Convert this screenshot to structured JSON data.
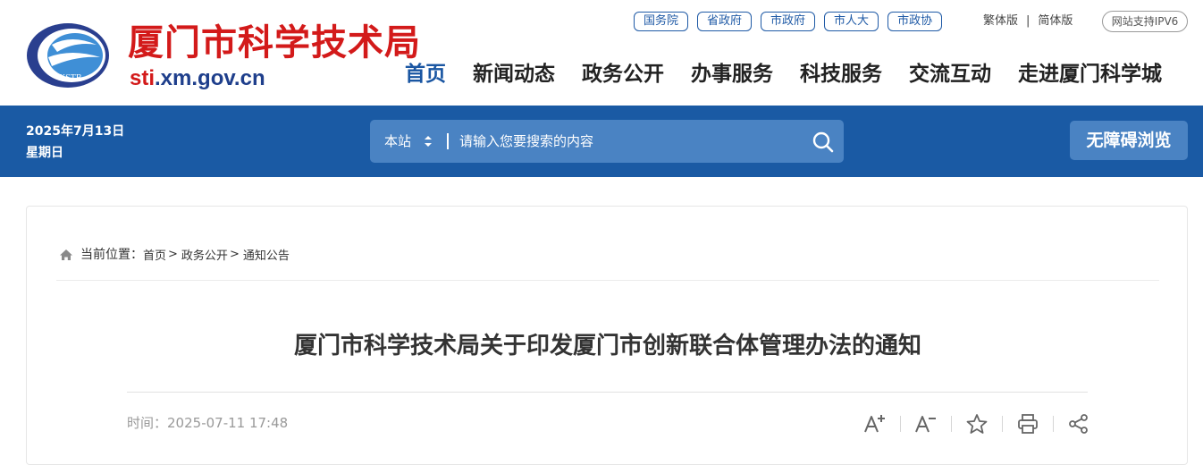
{
  "site": {
    "title": "厦门市科学技术局",
    "domain_prefix": "sti",
    "domain_suffix": ".xm.gov.cn",
    "emblem_text": "XSTB"
  },
  "top_links": [
    "国务院",
    "省政府",
    "市政府",
    "市人大",
    "市政协"
  ],
  "lang": {
    "traditional": "繁体版",
    "separator": "|",
    "simplified": "简体版"
  },
  "ipv6_badge": "网站支持IPV6",
  "nav": [
    {
      "label": "首页",
      "active": true
    },
    {
      "label": "新闻动态",
      "active": false
    },
    {
      "label": "政务公开",
      "active": false
    },
    {
      "label": "办事服务",
      "active": false
    },
    {
      "label": "科技服务",
      "active": false
    },
    {
      "label": "交流互动",
      "active": false
    },
    {
      "label": "走进厦门科学城",
      "active": false
    }
  ],
  "date": {
    "date_text": "2025年7月13日",
    "weekday": "星期日"
  },
  "search": {
    "scope_label": "本站",
    "placeholder": "请输入您要搜索的内容",
    "button_icon": "search-icon"
  },
  "accessibility_label": "无障碍浏览",
  "breadcrumb": {
    "label": "当前位置：",
    "items": [
      "首页",
      "政务公开",
      "通知公告"
    ],
    "separator": ">"
  },
  "article": {
    "title": "厦门市科学技术局关于印发厦门市创新联合体管理办法的通知",
    "time_label": "时间：",
    "time_value": "2025-07-11 17:48"
  },
  "tools": [
    "font-increase-icon",
    "font-decrease-icon",
    "favorite-star-icon",
    "print-icon",
    "share-icon"
  ],
  "colors": {
    "brand_blue": "#1a5aa4",
    "search_bg": "#4a83c3",
    "title_red": "#d31a1a",
    "nav_active": "#1a56a2"
  }
}
